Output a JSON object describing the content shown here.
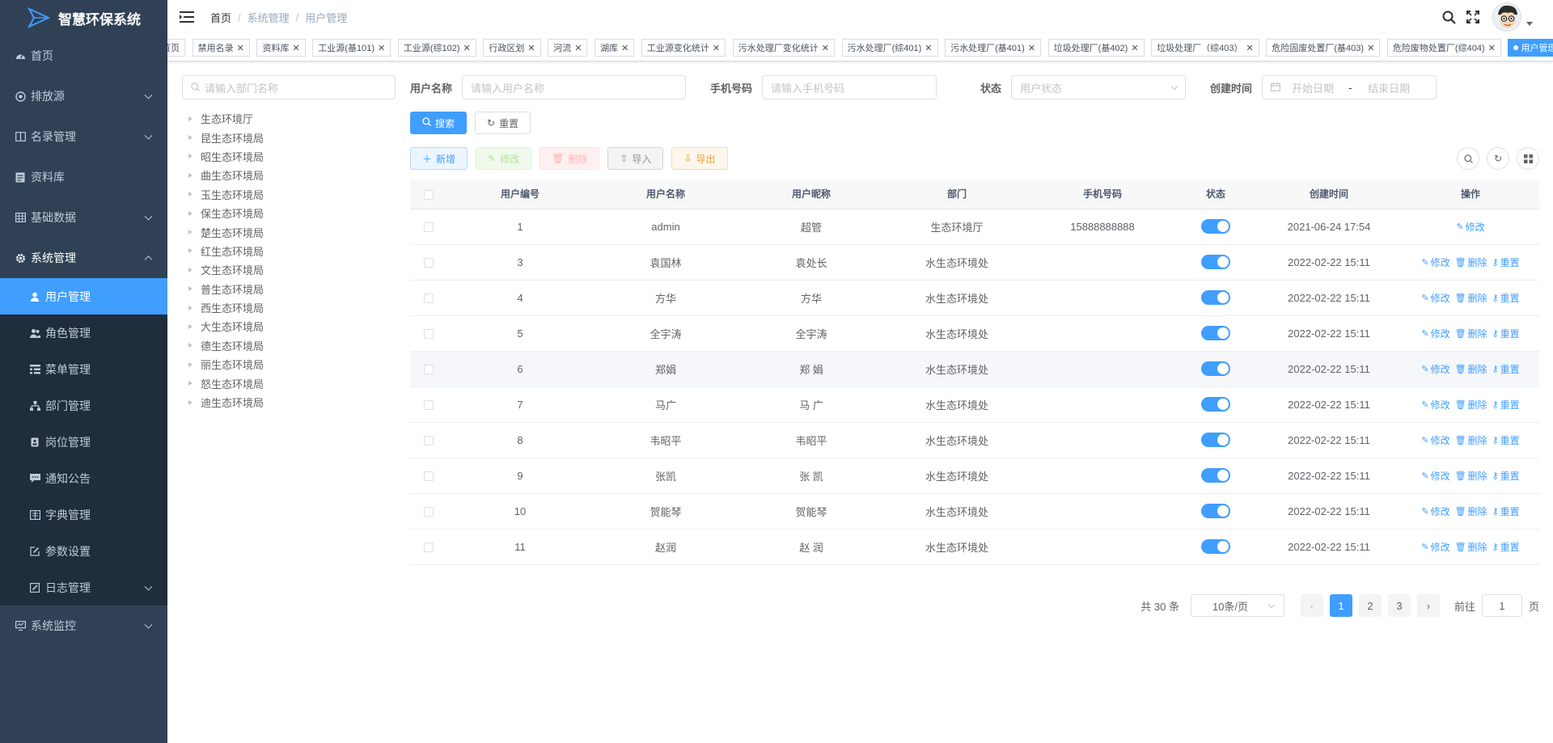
{
  "app": {
    "title": "智慧环保系统"
  },
  "sidebar": {
    "items": [
      {
        "label": "首页",
        "icon": "dashboard-icon"
      },
      {
        "label": "排放源",
        "icon": "target-icon"
      },
      {
        "label": "名录管理",
        "icon": "book-icon"
      },
      {
        "label": "资料库",
        "icon": "document-icon"
      },
      {
        "label": "基础数据",
        "icon": "grid-icon"
      },
      {
        "label": "系统管理",
        "icon": "gear-icon"
      }
    ],
    "sub_items": [
      {
        "label": "用户管理",
        "icon": "user-icon"
      },
      {
        "label": "角色管理",
        "icon": "peoples-icon"
      },
      {
        "label": "菜单管理",
        "icon": "tree-table-icon"
      },
      {
        "label": "部门管理",
        "icon": "tree-icon"
      },
      {
        "label": "岗位管理",
        "icon": "post-icon"
      },
      {
        "label": "通知公告",
        "icon": "message-icon"
      },
      {
        "label": "字典管理",
        "icon": "dict-icon"
      },
      {
        "label": "参数设置",
        "icon": "edit-icon"
      },
      {
        "label": "日志管理",
        "icon": "log-icon"
      }
    ],
    "bottom_item": {
      "label": "系统监控",
      "icon": "monitor-icon"
    }
  },
  "breadcrumb": [
    "首页",
    "系统管理",
    "用户管理"
  ],
  "tags": [
    "首页",
    "禁用名录",
    "资料库",
    "工业源(基101)",
    "工业源(综102)",
    "行政区划",
    "河流",
    "湖库",
    "工业源变化统计",
    "污水处理厂变化统计",
    "污水处理厂(综401)",
    "污水处理厂(基401)",
    "垃圾处理厂(基402)",
    "垃圾处理厂（综403）",
    "危险固废处置厂(基403)",
    "危险废物处置厂(综404)",
    "用户管理"
  ],
  "dept": {
    "placeholder": "请输入部门名称",
    "nodes": [
      "生态环境厅",
      "昆生态环境局",
      "昭生态环境局",
      "曲生态环境局",
      "玉生态环境局",
      "保生态环境局",
      "楚生态环境局",
      "红生态环境局",
      "文生态环境局",
      "普生态环境局",
      "西生态环境局",
      "大生态环境局",
      "德生态环境局",
      "丽生态环境局",
      "怒生态环境局",
      "迪生态环境局"
    ]
  },
  "filters": {
    "username_label": "用户名称",
    "username_placeholder": "请输入用户名称",
    "phone_label": "手机号码",
    "phone_placeholder": "请输入手机号码",
    "status_label": "状态",
    "status_placeholder": "用户状态",
    "time_label": "创建时间",
    "start_placeholder": "开始日期",
    "range_sep": "-",
    "end_placeholder": "结束日期",
    "search_btn": "搜索",
    "reset_btn": "重置"
  },
  "toolbar": {
    "add": "新增",
    "edit": "修改",
    "delete": "删除",
    "import": "导入",
    "export": "导出"
  },
  "table": {
    "headers": [
      "用户编号",
      "用户名称",
      "用户昵称",
      "部门",
      "手机号码",
      "状态",
      "创建时间",
      "操作"
    ],
    "ops": {
      "edit": "修改",
      "delete": "删除",
      "reset": "重置"
    },
    "rows": [
      {
        "id": "1",
        "name": "admin",
        "nick": "超管",
        "dept": "生态环境厅",
        "phone": "15888888888",
        "enabled": true,
        "time": "2021-06-24 17:54"
      },
      {
        "id": "3",
        "name": "袁国林",
        "nick": "袁处长",
        "dept": "水生态环境处",
        "phone": "",
        "enabled": true,
        "time": "2022-02-22 15:11"
      },
      {
        "id": "4",
        "name": "方华",
        "nick": "方华",
        "dept": "水生态环境处",
        "phone": "",
        "enabled": true,
        "time": "2022-02-22 15:11"
      },
      {
        "id": "5",
        "name": "全宇涛",
        "nick": "全宇涛",
        "dept": "水生态环境处",
        "phone": "",
        "enabled": true,
        "time": "2022-02-22 15:11"
      },
      {
        "id": "6",
        "name": "郑娟",
        "nick": "郑 娟",
        "dept": "水生态环境处",
        "phone": "",
        "enabled": true,
        "time": "2022-02-22 15:11"
      },
      {
        "id": "7",
        "name": "马广",
        "nick": "马 广",
        "dept": "水生态环境处",
        "phone": "",
        "enabled": true,
        "time": "2022-02-22 15:11"
      },
      {
        "id": "8",
        "name": "韦昭平",
        "nick": "韦昭平",
        "dept": "水生态环境处",
        "phone": "",
        "enabled": true,
        "time": "2022-02-22 15:11"
      },
      {
        "id": "9",
        "name": "张凯",
        "nick": "张 凯",
        "dept": "水生态环境处",
        "phone": "",
        "enabled": true,
        "time": "2022-02-22 15:11"
      },
      {
        "id": "10",
        "name": "贺能琴",
        "nick": "贺能琴",
        "dept": "水生态环境处",
        "phone": "",
        "enabled": true,
        "time": "2022-02-22 15:11"
      },
      {
        "id": "11",
        "name": "赵润",
        "nick": "赵 润",
        "dept": "水生态环境处",
        "phone": "",
        "enabled": true,
        "time": "2022-02-22 15:11"
      }
    ]
  },
  "pagination": {
    "total": "共 30 条",
    "page_size": "10条/页",
    "pages": [
      "1",
      "2",
      "3"
    ],
    "current": "1",
    "goto_label": "前往",
    "goto_value": "1",
    "page_suffix": "页"
  },
  "colors": {
    "sidebar_bg": "#304156",
    "submenu_bg": "#1f2d3d",
    "primary": "#409eff"
  }
}
